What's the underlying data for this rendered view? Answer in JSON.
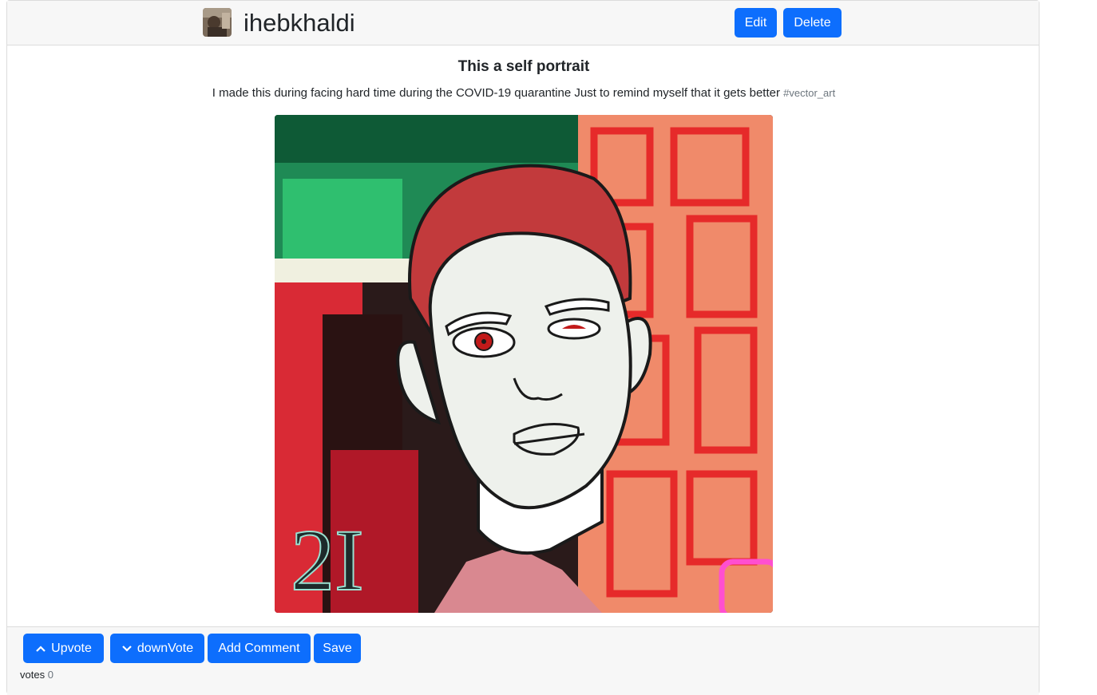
{
  "header": {
    "username": "ihebkhaldi",
    "edit_label": "Edit",
    "delete_label": "Delete"
  },
  "post": {
    "title": "This a self portrait",
    "description": "I made this during facing hard time during the COVID-19 quarantine Just to remind myself that it gets better",
    "tag": "#vector_art",
    "artwork_signature": "2I"
  },
  "footer": {
    "upvote_label": "Upvote",
    "downvote_label": "downVote",
    "add_comment_label": "Add Comment",
    "save_label": "Save",
    "votes_label": "votes",
    "votes_count": "0"
  },
  "colors": {
    "primary": "#0d6efd",
    "header_bg": "#f7f7f7",
    "tag": "#6c757d"
  },
  "icons": {
    "upvote": "chevron-up-icon",
    "downvote": "chevron-down-icon"
  }
}
